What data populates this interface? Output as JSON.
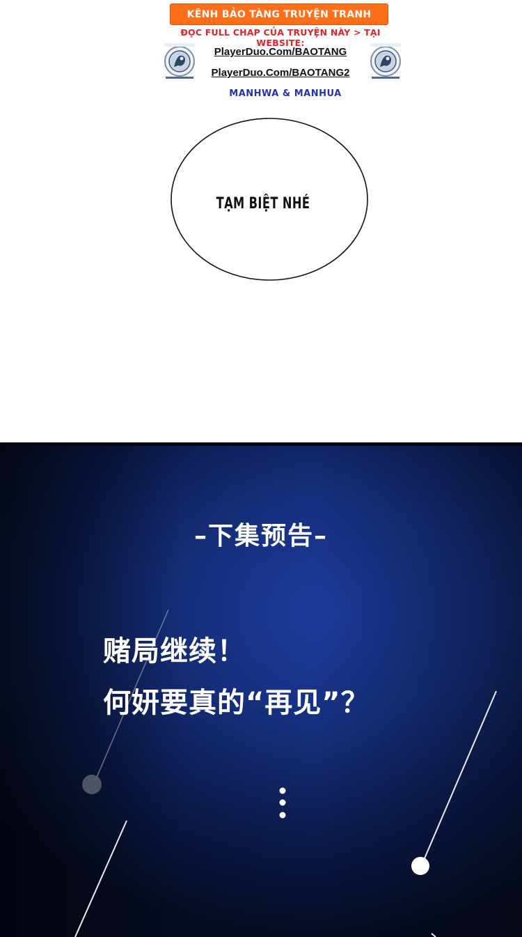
{
  "header": {
    "banner": "KÊNH BẢO TÀNG TRUYỆN TRANH",
    "subline": "ĐỌC FULL CHAP CỦA TRUYỆN NÀY > TẠI WEBSITE:",
    "links": [
      "PlayerDuo.Com/BAOTANG",
      "PlayerDuo.Com/BAOTANG2"
    ],
    "genre": "MANHWA & MANHUA",
    "logo_icon": "bao-tang-logo-icon",
    "colors": {
      "banner_bg": "#ff6f1a",
      "subline": "#e2232a",
      "genre": "#2433a8"
    }
  },
  "panel1": {
    "speech": "TẠM BIỆT NHÉ"
  },
  "panel2": {
    "title": "–下集预告–",
    "lines": [
      "赌局继续！",
      "何妍要真的“再见”？"
    ],
    "background_color": "#16307f"
  }
}
